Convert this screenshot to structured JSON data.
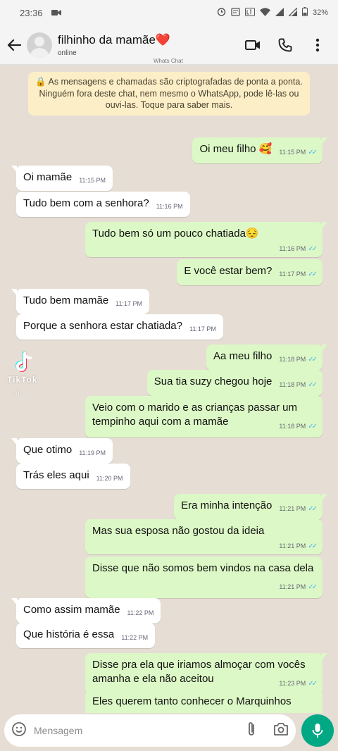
{
  "status_bar": {
    "time": "23:36",
    "battery": "32%"
  },
  "header": {
    "contact_name": "filhinho da mamãe❤️",
    "contact_status": "online",
    "watermark": "Whats Chat"
  },
  "encryption_notice": {
    "line1": "🔒 As mensagens e chamadas são criptografadas de ponta a ponta.",
    "line2": "Ninguém fora deste chat, nem mesmo o WhatsApp, pode lê-las ou ouvi-las. Toque para saber mais."
  },
  "messages": [
    {
      "dir": "out",
      "text": "Oi meu filho 🥰",
      "time": "11:15 PM"
    },
    {
      "dir": "in",
      "text": "Oi mamãe",
      "time": "11:15 PM"
    },
    {
      "dir": "in",
      "text": "Tudo bem com a senhora?",
      "time": "11:16 PM"
    },
    {
      "dir": "out",
      "text": "Tudo bem só um pouco chatiada😔",
      "time": "11:16 PM"
    },
    {
      "dir": "out",
      "text": "E você estar bem?",
      "time": "11:17 PM"
    },
    {
      "dir": "in",
      "text": "Tudo bem mamãe",
      "time": "11:17 PM"
    },
    {
      "dir": "in",
      "text": "Porque a senhora estar chatiada?",
      "time": "11:17 PM"
    },
    {
      "dir": "out",
      "text": "Aa meu filho",
      "time": "11:18 PM"
    },
    {
      "dir": "out",
      "text": "Sua tia suzy chegou hoje",
      "time": "11:18 PM"
    },
    {
      "dir": "out",
      "text": "Veio com o marido e as crianças passar um tempinho aqui com a mamãe",
      "time": "11:18 PM"
    },
    {
      "dir": "in",
      "text": "Que otimo",
      "time": "11:19 PM"
    },
    {
      "dir": "in",
      "text": "Trás eles aqui",
      "time": "11:20 PM"
    },
    {
      "dir": "out",
      "text": "Era minha intenção",
      "time": "11:21 PM"
    },
    {
      "dir": "out",
      "text": "Mas sua esposa não gostou da ideia",
      "time": "11:21 PM"
    },
    {
      "dir": "out",
      "text": "Disse que não somos bem vindos na casa dela",
      "time": "11:21 PM"
    },
    {
      "dir": "in",
      "text": "Como assim mamãe",
      "time": "11:22 PM"
    },
    {
      "dir": "in",
      "text": "Que história é essa",
      "time": "11:22 PM"
    },
    {
      "dir": "out",
      "text": "Disse pra ela que iriamos almoçar com vocês amanha e ela não aceitou",
      "time": "11:23 PM"
    },
    {
      "dir": "out",
      "text": "Eles querem tanto conhecer o Marquinhos",
      "time": ""
    }
  ],
  "overlay": {
    "tiktok_label": "TikTok",
    "tiktok_user": "@..."
  },
  "input": {
    "placeholder": "Mensagem"
  },
  "colors": {
    "incoming_bubble": "#ffffff",
    "outgoing_bubble": "#dcf8c6",
    "read_ticks": "#4fb6ec",
    "notice_bg": "#fcefc7",
    "mic_button": "#00a884"
  }
}
